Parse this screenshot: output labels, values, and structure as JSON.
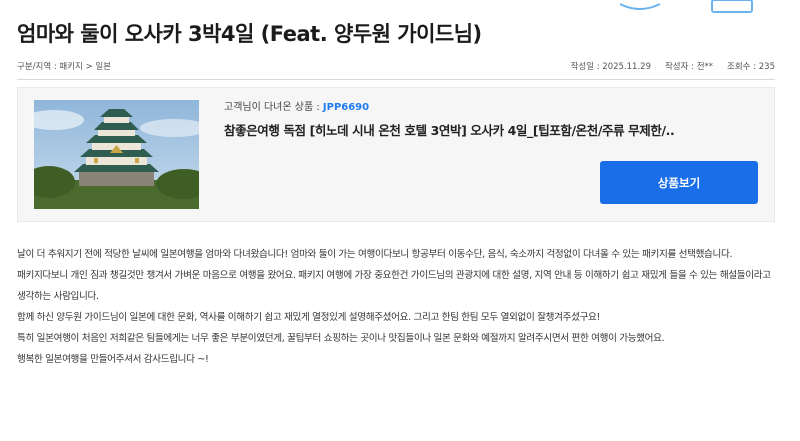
{
  "title": "엄마와 둘이 오사카 3박4일 (Feat. 양두원 가이드님)",
  "meta": {
    "category": "구분/지역 : 패키지 > 일본",
    "date": "작성일 : 2025.11.29",
    "author": "작성자 : 전**",
    "views": "조회수 : 235"
  },
  "product": {
    "label_prefix": "고객님이 다녀온 상품 : ",
    "code": "JPP6690",
    "name": "참좋은여행 독점 [히노데 시내 온천 호텔 3연박] 오사카 4일_[팁포함/온천/주류 무제한/..",
    "button_label": "상품보기",
    "image_icon": "osaka-castle-photo"
  },
  "content": [
    "날이 더 추워지기 전에 적당한 날씨에 일본여행을 엄마와 다녀왔습니다! 엄마와 둘이 가는 여행이다보니 항공부터 이동수단, 음식, 숙소까지 걱정없이 다녀올 수 있는 패키지를 선택했습니다.",
    "패키지다보니 개인 짐과 챙길것만 챙겨서 가벼운 마음으로 여행을 왔어요. 패키지 여행에 가장 중요한건 가이드님의 관광지에 대한 설명, 지역 안내 등 이해하기 쉽고 재밌게 들을 수 있는 해설들이라고 생각하는 사람입니다.",
    "함께 하신 양두원 가이드님이 일본에 대한 문화, 역사를 이해하기 쉽고 재밌게 열정있게 설명해주셨어요. 그리고 한팀 한팀 모두 열외없이 잘챙겨주셨구요!",
    "특히 일본여행이 처음인 저희같은 팀들에게는 너무 좋은 부분이였던게, 꿀팁부터 쇼핑하는 곳이나 맛집들이나 일본 문화와 예절까지 알려주시면서 편한 여행이 가능했어요.",
    "행복한 일본여행을 만들어주셔서 감사드립니다 ~!"
  ],
  "colors": {
    "accent": "#1a6fe8",
    "code": "#1f7cf0",
    "card_bg": "#f6f6f7"
  }
}
